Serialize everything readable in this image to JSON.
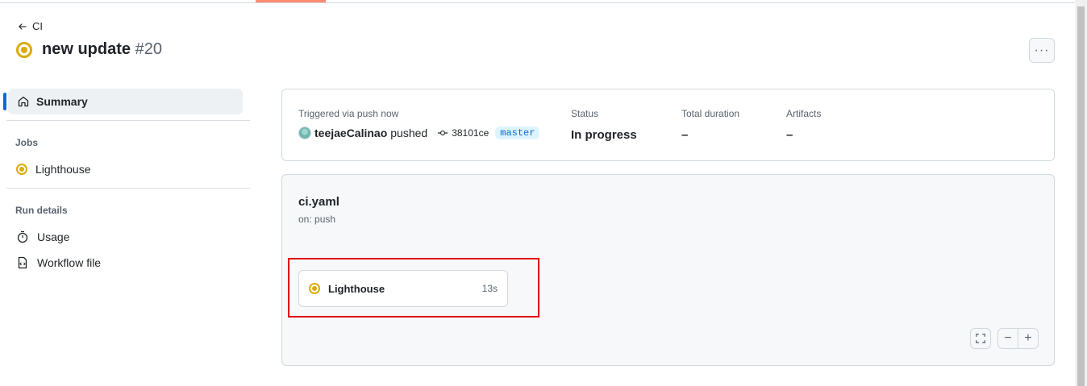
{
  "header": {
    "back_label": "CI",
    "run_name": "new update",
    "run_number": "#20",
    "more_icon": "kebab-horizontal-icon"
  },
  "sidebar": {
    "summary_label": "Summary",
    "jobs_heading": "Jobs",
    "jobs": [
      {
        "label": "Lighthouse",
        "status": "in_progress"
      }
    ],
    "run_details_heading": "Run details",
    "run_details": [
      {
        "label": "Usage",
        "icon": "stopwatch-icon"
      },
      {
        "label": "Workflow file",
        "icon": "file-code-icon"
      }
    ]
  },
  "summary": {
    "trigger_label": "Triggered via push now",
    "actor": "teejaeCalinao",
    "action": "pushed",
    "commit_sha": "38101ce",
    "branch": "master",
    "status_label": "Status",
    "status_value": "In progress",
    "duration_label": "Total duration",
    "duration_value": "–",
    "artifacts_label": "Artifacts",
    "artifacts_value": "–"
  },
  "workflow": {
    "file": "ci.yaml",
    "trigger": "on: push",
    "job_name": "Lighthouse",
    "job_duration": "13s"
  },
  "colors": {
    "in_progress": "#dbab0a",
    "accent": "#0969da",
    "highlight": "#e00000"
  }
}
